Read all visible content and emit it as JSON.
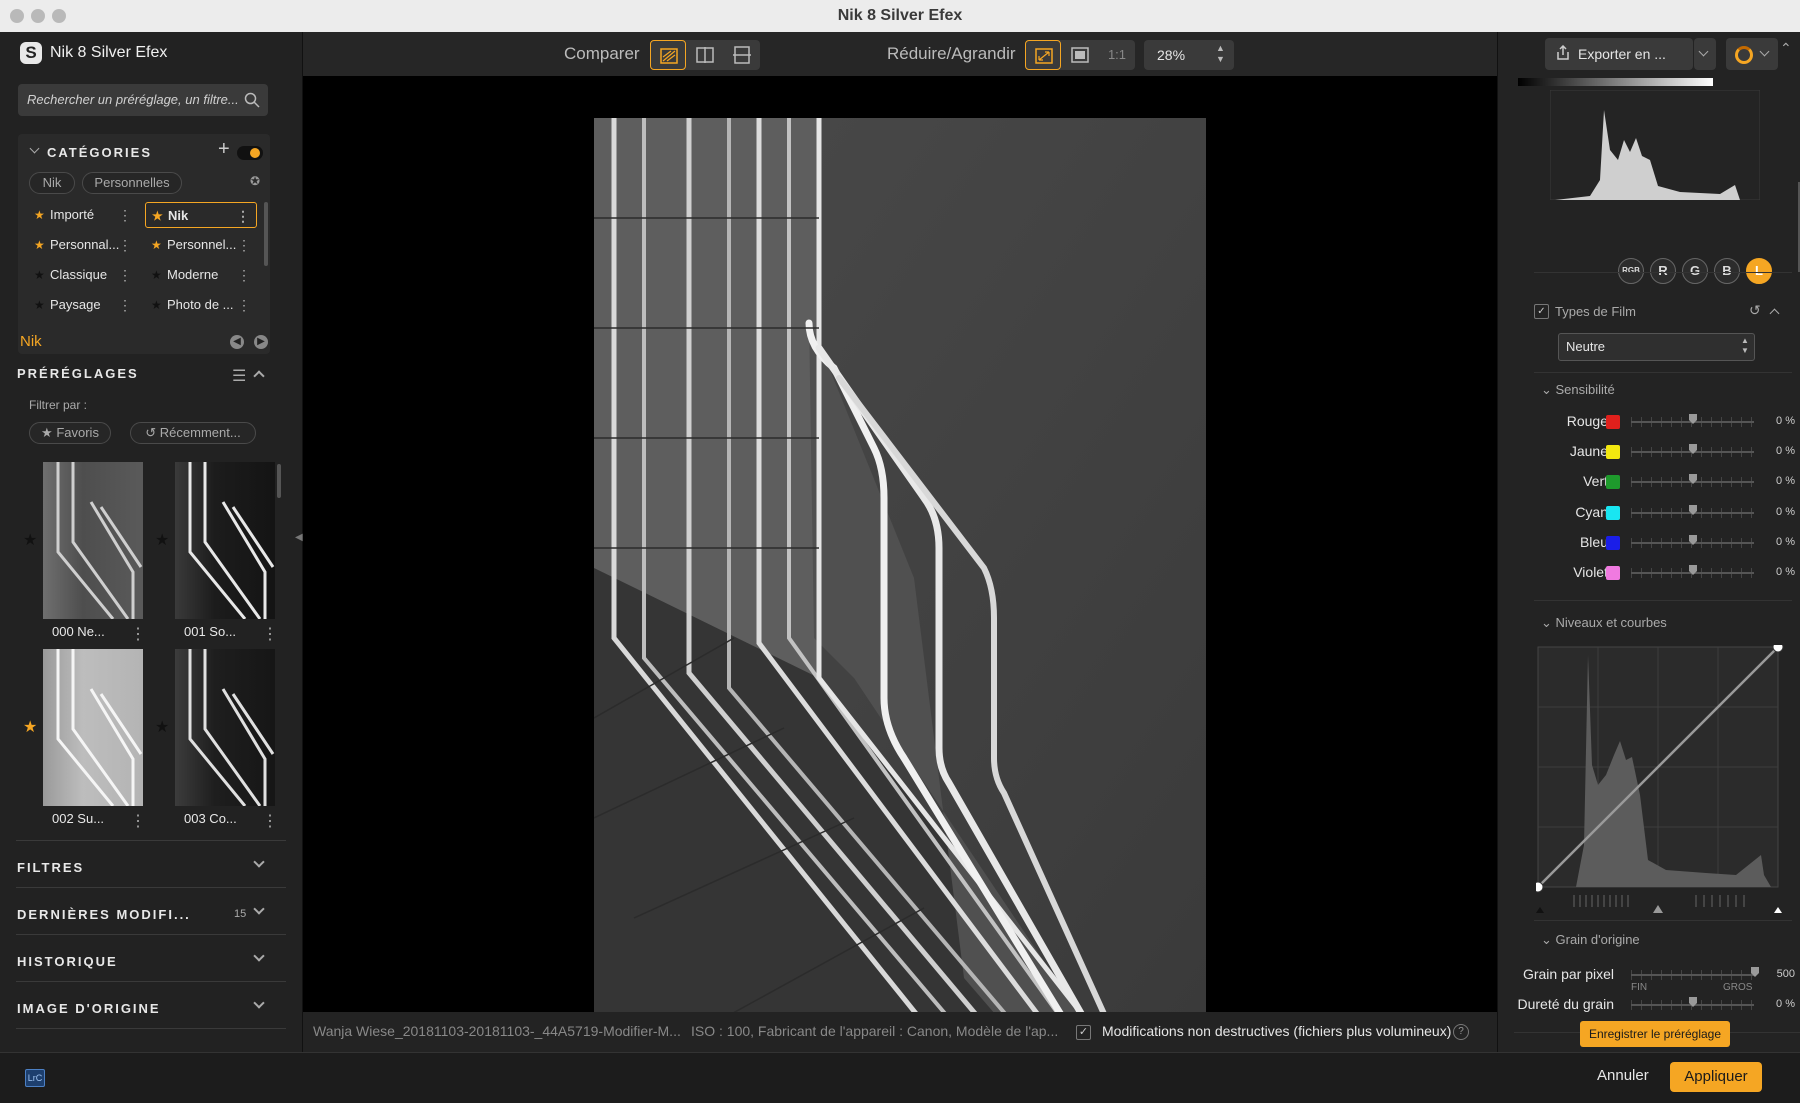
{
  "window": {
    "title": "Nik 8 Silver Efex"
  },
  "colors": {
    "accent": "#f5a623",
    "panel": "#222222",
    "canvas": "#000000"
  },
  "left": {
    "app_name": "Nik 8 Silver Efex",
    "search_placeholder": "Rechercher un préréglage, un filtre...",
    "categories_title": "CATÉGORIES",
    "category_tabs": [
      "Nik",
      "Personnelles"
    ],
    "category_items": [
      {
        "label": "Importé",
        "starred": true
      },
      {
        "label": "Nik",
        "starred": true,
        "selected": true
      },
      {
        "label": "Personnal...",
        "starred": true
      },
      {
        "label": "Personnel...",
        "starred": true
      },
      {
        "label": "Classique",
        "starred": false
      },
      {
        "label": "Moderne",
        "starred": false
      },
      {
        "label": "Paysage",
        "starred": false
      },
      {
        "label": "Photo de ...",
        "starred": false
      }
    ],
    "current_category": "Nik",
    "presets_title": "PRÉRÉGLAGES",
    "filter_by": "Filtrer par :",
    "filter_favorites": "Favoris",
    "filter_recent": "Récemment...",
    "presets": [
      {
        "label": "000 Ne...",
        "favorite": false,
        "tone": "mid"
      },
      {
        "label": "001 So...",
        "favorite": false,
        "tone": "dark"
      },
      {
        "label": "002 Su...",
        "favorite": true,
        "tone": "light"
      },
      {
        "label": "003 Co...",
        "favorite": false,
        "tone": "dark"
      }
    ],
    "sections": [
      {
        "title": "FILTRES",
        "count": ""
      },
      {
        "title": "DERNIÈRES MODIFI...",
        "count": "15"
      },
      {
        "title": "HISTORIQUE",
        "count": ""
      },
      {
        "title": "IMAGE D'ORIGINE",
        "count": ""
      }
    ]
  },
  "toolbar": {
    "compare_label": "Comparer",
    "zoom_label": "Réduire/Agrandir",
    "one_to_one": "1:1",
    "zoom_value": "28%"
  },
  "status": {
    "filename": "Wanja Wiese_20181103-20181103-_44A5719-Modifier-M...",
    "exif": "ISO : 100, Fabricant de l'appareil : Canon, Modèle de l'ap...",
    "nondestructive_label": "Modifications non destructives (fichiers plus volumineux)",
    "nondestructive_checked": true
  },
  "right": {
    "export_label": "Exporter en ...",
    "channels": [
      "RGB",
      "R",
      "G",
      "B",
      "L"
    ],
    "active_channel": "L",
    "film_types_label": "Types de Film",
    "film_type_value": "Neutre",
    "sensitivity_title": "Sensibilité",
    "sensitivity": [
      {
        "name": "Rouge",
        "color": "#e0201c",
        "value": "0 %"
      },
      {
        "name": "Jaune",
        "color": "#f3e80f",
        "value": "0 %"
      },
      {
        "name": "Vert",
        "color": "#1e9a2c",
        "value": "0 %"
      },
      {
        "name": "Cyan",
        "color": "#19e6f2",
        "value": "0 %"
      },
      {
        "name": "Bleu",
        "color": "#1a1ee8",
        "value": "0 %"
      },
      {
        "name": "Violet",
        "color": "#f07ae0",
        "value": "0 %"
      }
    ],
    "levels_title": "Niveaux et courbes",
    "grain_title": "Grain d'origine",
    "grain_per_pixel_label": "Grain par pixel",
    "grain_per_pixel_value": "500",
    "grain_fine": "FIN",
    "grain_coarse": "GROS",
    "grain_hardness_label": "Dureté du grain",
    "grain_hardness_value": "0 %",
    "save_preset_label": "Enregistrer le préréglage"
  },
  "bottom": {
    "badge": "LrC",
    "cancel_label": "Annuler",
    "apply_label": "Appliquer"
  }
}
